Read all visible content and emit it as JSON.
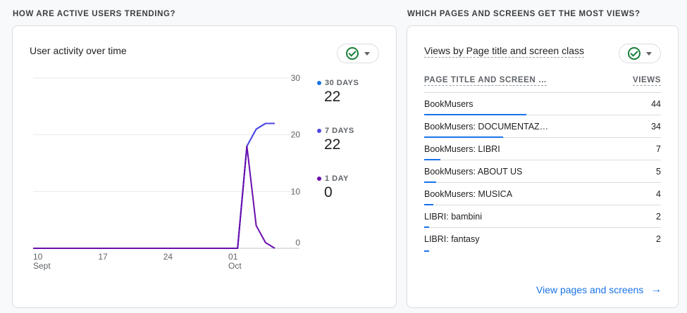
{
  "left_section": {
    "heading": "HOW ARE ACTIVE USERS TRENDING?"
  },
  "right_section": {
    "heading": "WHICH PAGES AND SCREENS GET THE MOST VIEWS?"
  },
  "activity_card": {
    "title": "User activity over time",
    "legend": [
      {
        "label": "30 DAYS",
        "value": "22",
        "color": "#1a73e8"
      },
      {
        "label": "7 DAYS",
        "value": "22",
        "color": "#4f46e5"
      },
      {
        "label": "1 DAY",
        "value": "0",
        "color": "#6a0dad"
      }
    ]
  },
  "views_card": {
    "title": "Views by Page title and screen class",
    "col_page": "PAGE TITLE AND SCREEN …",
    "col_views": "VIEWS",
    "rows": [
      {
        "name": "BookMusers",
        "views": "44"
      },
      {
        "name": "BookMusers: DOCUMENTAZ…",
        "views": "34"
      },
      {
        "name": "BookMusers: LIBRI",
        "views": "7"
      },
      {
        "name": "BookMusers: ABOUT US",
        "views": "5"
      },
      {
        "name": "BookMusers: MUSICA",
        "views": "4"
      },
      {
        "name": "LIBRI: bambini",
        "views": "2"
      },
      {
        "name": "LIBRI: fantasy",
        "views": "2"
      }
    ],
    "link_label": "View pages and screens"
  },
  "chart_data": {
    "type": "line",
    "title": "User activity over time",
    "ylim": [
      0,
      30
    ],
    "y_ticks": [
      "0",
      "10",
      "20",
      "30"
    ],
    "x_ticks": [
      {
        "day": "10",
        "month": "Sept"
      },
      {
        "day": "17",
        "month": ""
      },
      {
        "day": "24",
        "month": ""
      },
      {
        "day": "01",
        "month": "Oct"
      }
    ],
    "x": [
      "09-10",
      "09-11",
      "09-12",
      "09-13",
      "09-14",
      "09-15",
      "09-16",
      "09-17",
      "09-18",
      "09-19",
      "09-20",
      "09-21",
      "09-22",
      "09-23",
      "09-24",
      "09-25",
      "09-26",
      "09-27",
      "09-28",
      "09-29",
      "09-30",
      "10-01",
      "10-02",
      "10-03",
      "10-04",
      "10-05",
      "10-06"
    ],
    "series": [
      {
        "name": "30 DAYS",
        "color": "#1a73e8",
        "values": [
          0,
          0,
          0,
          0,
          0,
          0,
          0,
          0,
          0,
          0,
          0,
          0,
          0,
          0,
          0,
          0,
          0,
          0,
          0,
          0,
          0,
          0,
          0,
          18,
          21,
          22,
          22
        ]
      },
      {
        "name": "7 DAYS",
        "color": "#4f46e5",
        "values": [
          0,
          0,
          0,
          0,
          0,
          0,
          0,
          0,
          0,
          0,
          0,
          0,
          0,
          0,
          0,
          0,
          0,
          0,
          0,
          0,
          0,
          0,
          0,
          18,
          21,
          22,
          22
        ]
      },
      {
        "name": "1 DAY",
        "color": "#6a0dad",
        "values": [
          0,
          0,
          0,
          0,
          0,
          0,
          0,
          0,
          0,
          0,
          0,
          0,
          0,
          0,
          0,
          0,
          0,
          0,
          0,
          0,
          0,
          0,
          0,
          18,
          4,
          1,
          0
        ]
      }
    ],
    "grid": true
  }
}
